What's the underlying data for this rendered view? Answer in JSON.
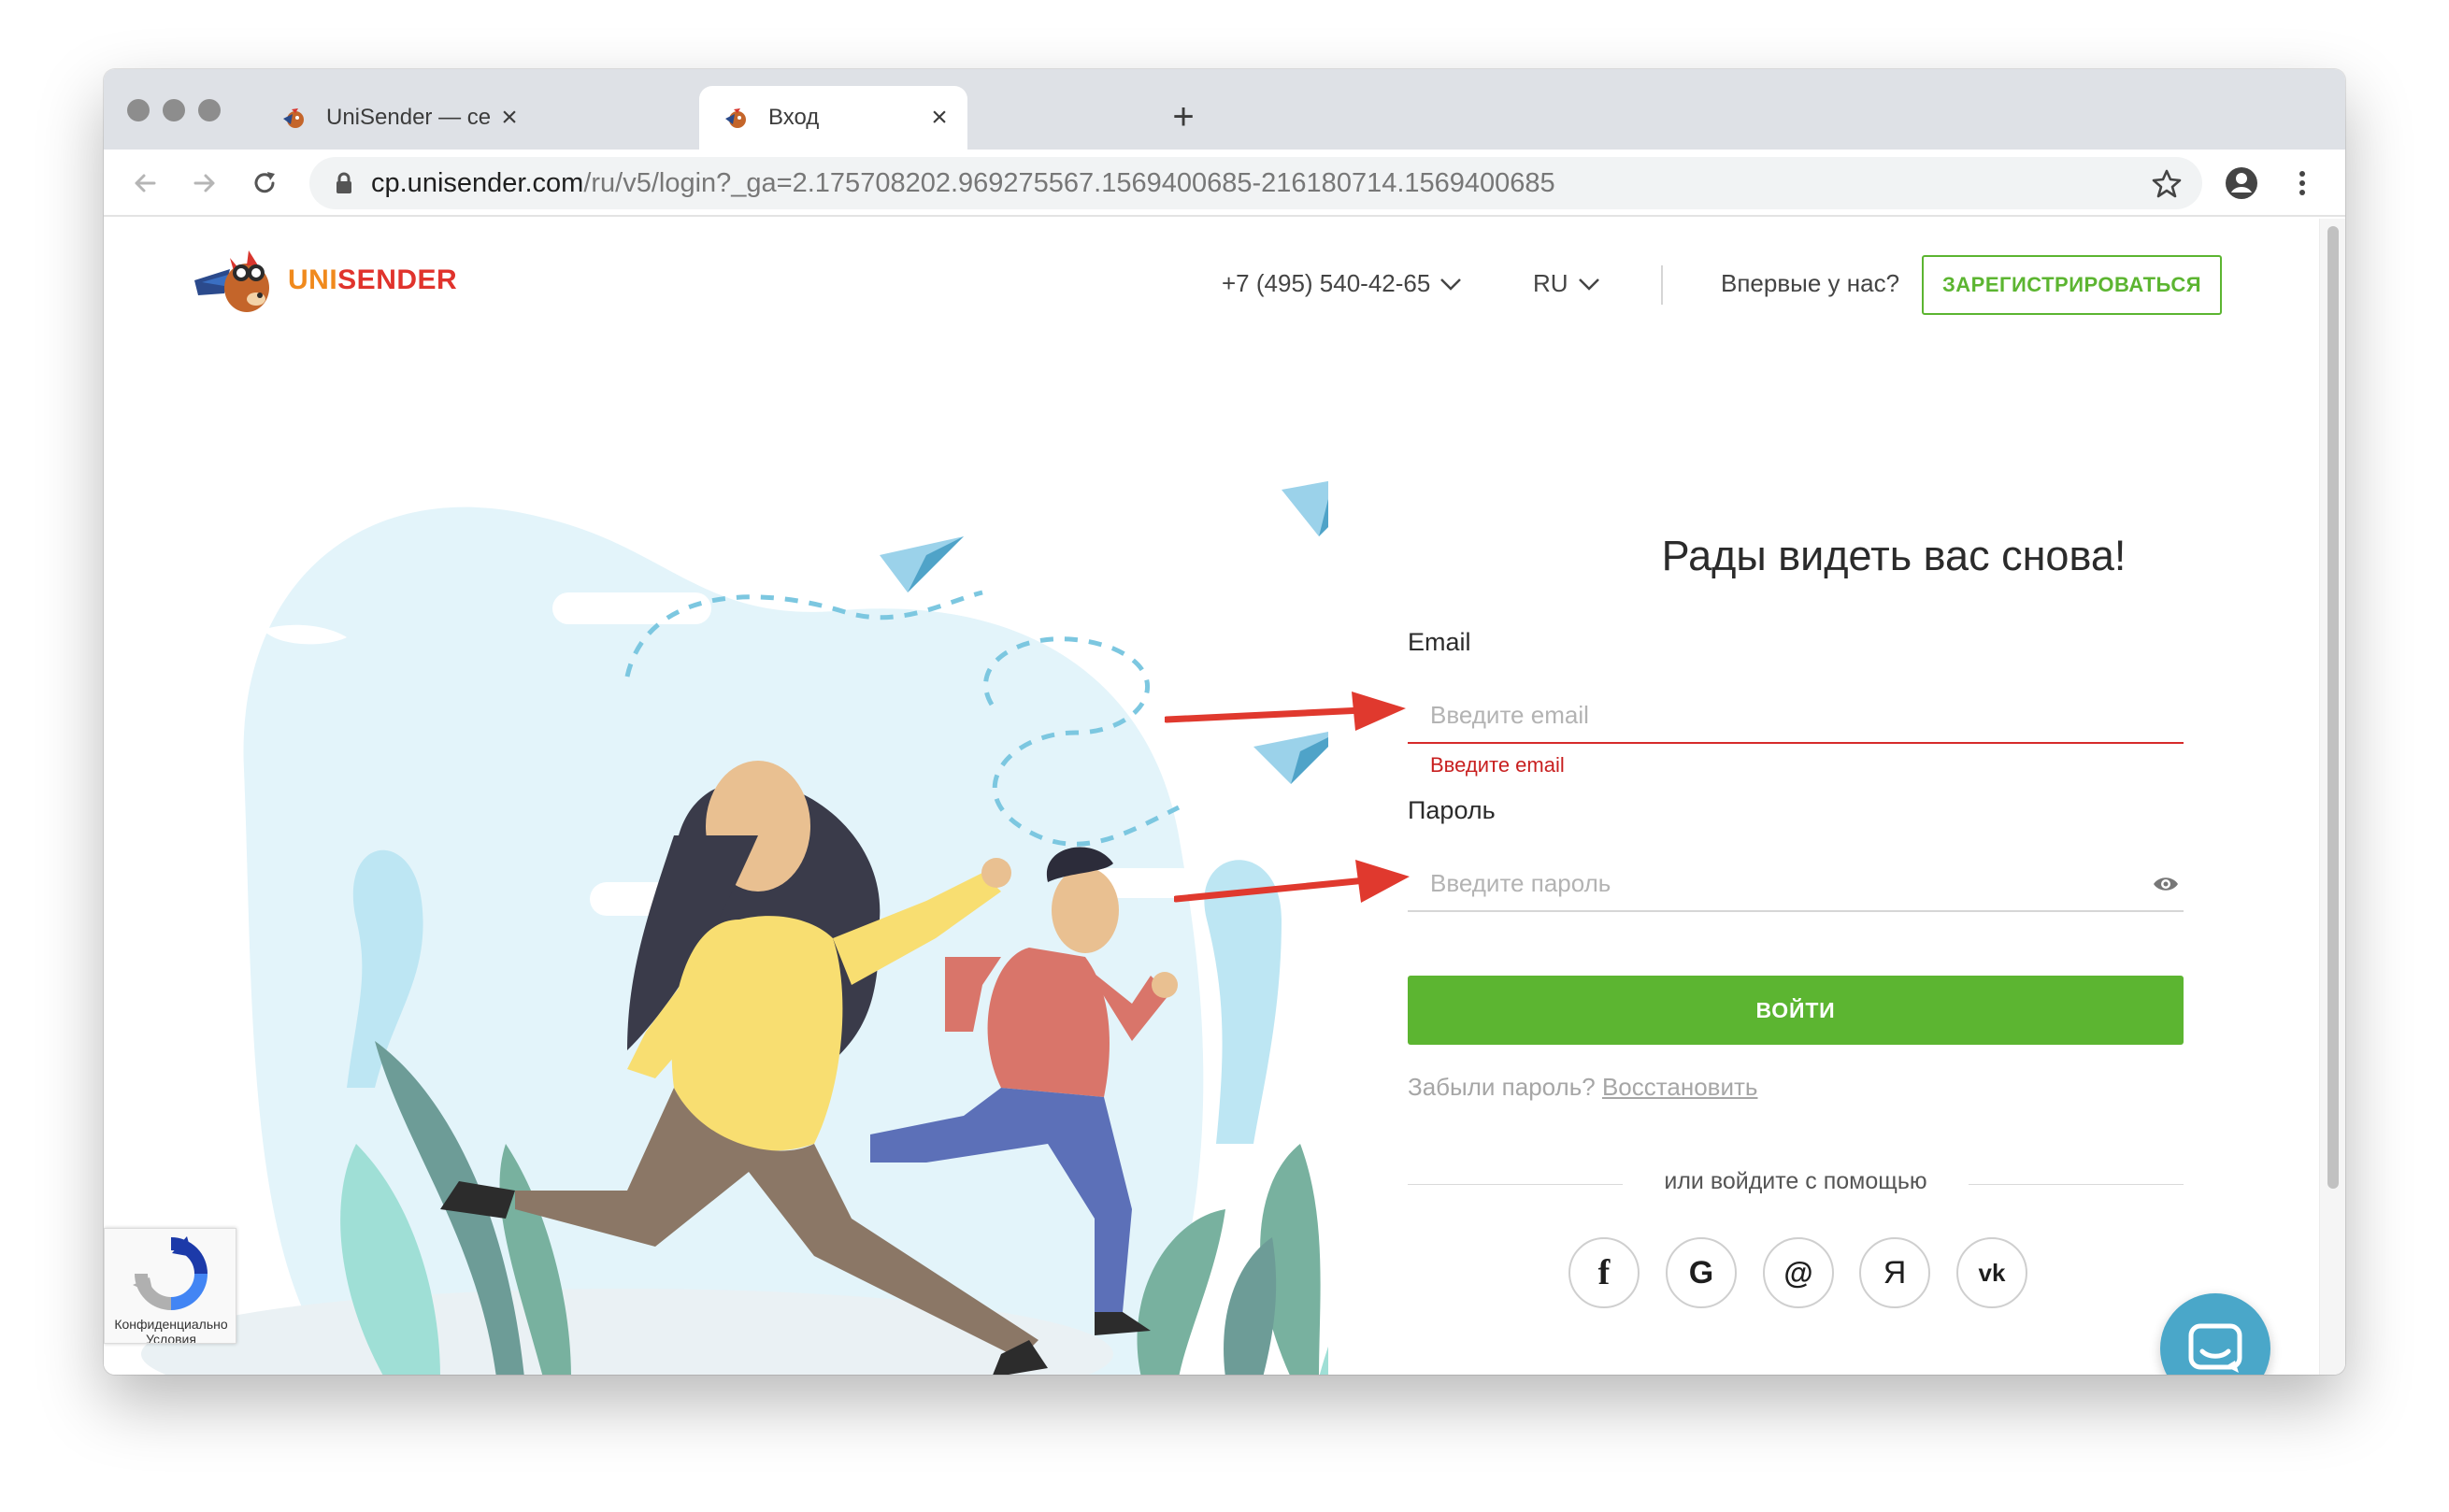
{
  "browser": {
    "tabs": [
      {
        "title": "UniSender — сервис массовых",
        "active": false
      },
      {
        "title": "Вход",
        "active": true
      }
    ],
    "url_host": "cp.unisender.com",
    "url_path": "/ru/v5/login?_ga=2.175708202.969275567.1569400685-216180714.1569400685"
  },
  "header": {
    "logo_uni": "UNI",
    "logo_sender": "SENDER",
    "phone": "+7 (495) 540-42-65",
    "language": "RU",
    "first_time_text": "Впервые у нас?",
    "register_label": "ЗАРЕГИСТРИРОВАТЬСЯ"
  },
  "form": {
    "heading": "Рады видеть вас снова!",
    "email_label": "Email",
    "email_placeholder": "Введите email",
    "email_value": "",
    "email_error": "Введите email",
    "password_label": "Пароль",
    "password_placeholder": "Введите пароль",
    "password_value": "",
    "login_label": "ВОЙТИ",
    "forgot_text": "Забыли пароль?",
    "restore_link": "Восстановить",
    "or_text": "или войдите с помощью"
  },
  "social": [
    {
      "label": "f",
      "icon": "facebook-icon"
    },
    {
      "label": "G",
      "icon": "google-icon"
    },
    {
      "label": "@",
      "icon": "mailru-icon"
    },
    {
      "label": "Я",
      "icon": "yandex-icon"
    },
    {
      "label": "vk",
      "icon": "vk-icon"
    }
  ],
  "recaptcha": {
    "text_1": "Конфиденциально",
    "text_2": "Условия"
  },
  "colors": {
    "brand_green": "#5cb531",
    "error_red": "#d62b2b",
    "annotation_arrow": "#e0392e",
    "chat_blue": "#4aa7c9",
    "logo_orange": "#f08a1d",
    "logo_red": "#e0332c"
  }
}
